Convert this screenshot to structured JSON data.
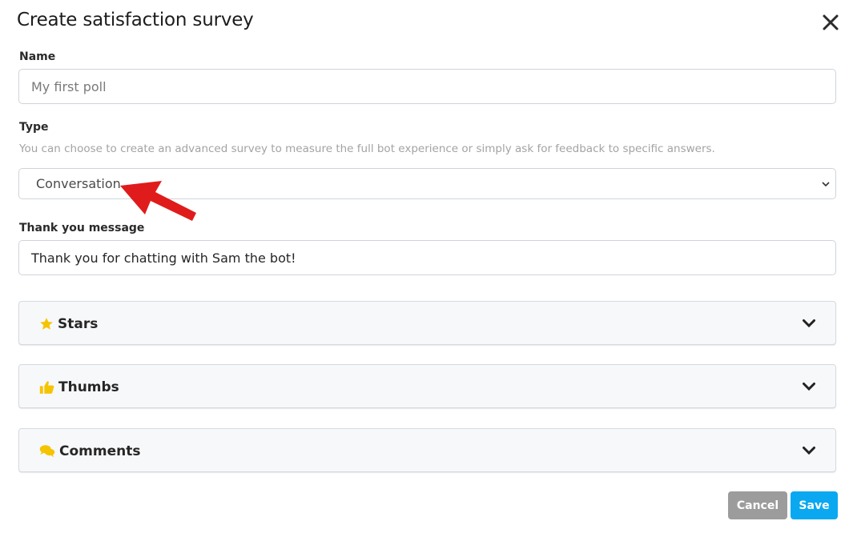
{
  "dialog": {
    "title": "Create satisfaction survey"
  },
  "form": {
    "name": {
      "label": "Name",
      "placeholder": "My first poll"
    },
    "type": {
      "label": "Type",
      "help": "You can choose to create an advanced survey to measure the full bot experience or simply ask for feedback to specific answers.",
      "selected": "Conversation"
    },
    "thank_you": {
      "label": "Thank you message",
      "value": "Thank you for chatting with Sam the bot!"
    }
  },
  "sections": [
    {
      "label": "Stars",
      "icon": "star-icon"
    },
    {
      "label": "Thumbs",
      "icon": "thumbs-up-icon"
    },
    {
      "label": "Comments",
      "icon": "comments-icon"
    }
  ],
  "footer": {
    "cancel_label": "Cancel",
    "save_label": "Save"
  },
  "colors": {
    "save": "#0aa8f0",
    "cancel": "#9c9c9c",
    "icon_accent": "#f5c400",
    "annotation_arrow": "#e01b1b"
  }
}
